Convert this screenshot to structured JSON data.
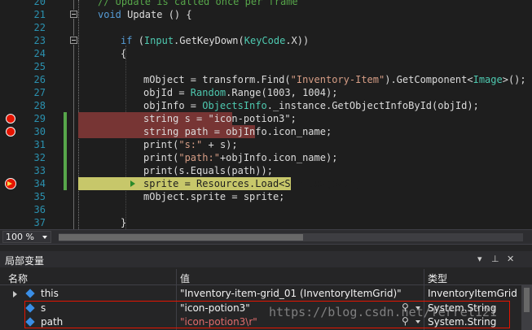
{
  "editor": {
    "lines": [
      {
        "num": "20",
        "segments": [
          {
            "t": "// Update is called once per frame",
            "c": "cmt"
          }
        ]
      },
      {
        "num": "21",
        "segments": [
          {
            "t": "void ",
            "c": "kw"
          },
          {
            "t": "Update",
            "c": "txt"
          },
          {
            "t": " () {",
            "c": "txt"
          }
        ]
      },
      {
        "num": "22",
        "segments": []
      },
      {
        "num": "23",
        "segments": [
          {
            "t": "if ",
            "c": "kw"
          },
          {
            "t": "(",
            "c": "txt"
          },
          {
            "t": "Input",
            "c": "type"
          },
          {
            "t": ".GetKeyDown(",
            "c": "txt"
          },
          {
            "t": "KeyCode",
            "c": "type"
          },
          {
            "t": ".X))",
            "c": "txt"
          }
        ]
      },
      {
        "num": "24",
        "segments": [
          {
            "t": "{",
            "c": "txt"
          }
        ]
      },
      {
        "num": "25",
        "segments": []
      },
      {
        "num": "26",
        "segments": [
          {
            "t": "mObject = transform.Find(",
            "c": "txt"
          },
          {
            "t": "\"Inventory-Item\"",
            "c": "str"
          },
          {
            "t": ").GetComponent<",
            "c": "txt"
          },
          {
            "t": "Image",
            "c": "type"
          },
          {
            "t": ">();",
            "c": "txt"
          }
        ]
      },
      {
        "num": "27",
        "segments": [
          {
            "t": "objId = ",
            "c": "txt"
          },
          {
            "t": "Random",
            "c": "type"
          },
          {
            "t": ".Range(1003, 1004);",
            "c": "txt"
          }
        ]
      },
      {
        "num": "28",
        "segments": [
          {
            "t": "objInfo = ",
            "c": "txt"
          },
          {
            "t": "ObjectsInfo",
            "c": "type"
          },
          {
            "t": "._instance.GetObjectInfoById(objId);",
            "c": "txt"
          }
        ]
      },
      {
        "num": "29",
        "segments": [
          {
            "t": "string ",
            "c": "txt"
          },
          {
            "t": "s = ",
            "c": "txt"
          },
          {
            "t": "\"icon-potion3\"",
            "c": "txt"
          },
          {
            "t": ";",
            "c": "txt"
          }
        ]
      },
      {
        "num": "30",
        "segments": [
          {
            "t": "string ",
            "c": "txt"
          },
          {
            "t": "path = objInfo.icon_name;",
            "c": "txt"
          }
        ]
      },
      {
        "num": "31",
        "segments": [
          {
            "t": "print(",
            "c": "txt"
          },
          {
            "t": "\"s:\"",
            "c": "str"
          },
          {
            "t": " + s);",
            "c": "txt"
          }
        ]
      },
      {
        "num": "32",
        "segments": [
          {
            "t": "print(",
            "c": "txt"
          },
          {
            "t": "\"path:\"",
            "c": "str"
          },
          {
            "t": "+objInfo.icon_name);",
            "c": "txt"
          }
        ]
      },
      {
        "num": "33",
        "segments": [
          {
            "t": "print(s.Equals(path));",
            "c": "txt"
          }
        ]
      },
      {
        "num": "34",
        "segments": [
          {
            "t": "sprite = Resources.Load<Sprite>(path);",
            "c": "dark"
          }
        ]
      },
      {
        "num": "35",
        "segments": [
          {
            "t": "mObject.sprite = sprite;",
            "c": "txt"
          }
        ]
      },
      {
        "num": "36",
        "segments": []
      },
      {
        "num": "37",
        "segments": [
          {
            "t": "}",
            "c": "txt"
          }
        ]
      }
    ]
  },
  "zoom": {
    "value": "100 %"
  },
  "locals": {
    "title": "局部变量",
    "headers": {
      "name": "名称",
      "value": "值",
      "type": "类型"
    },
    "rows": [
      {
        "name": "this",
        "value": "\"Inventory-item-grid_01 (InventoryItemGrid)\"",
        "type": "InventoryItemGrid",
        "expandable": true
      },
      {
        "name": "s",
        "value": "\"icon-potion3\"",
        "type": "System.String",
        "expandable": false
      },
      {
        "name": "path",
        "value": "\"icon-potion3\\r\"",
        "type": "System.String",
        "expandable": false
      }
    ]
  },
  "watermark": "https://blog.csdn.net/ferrel121"
}
